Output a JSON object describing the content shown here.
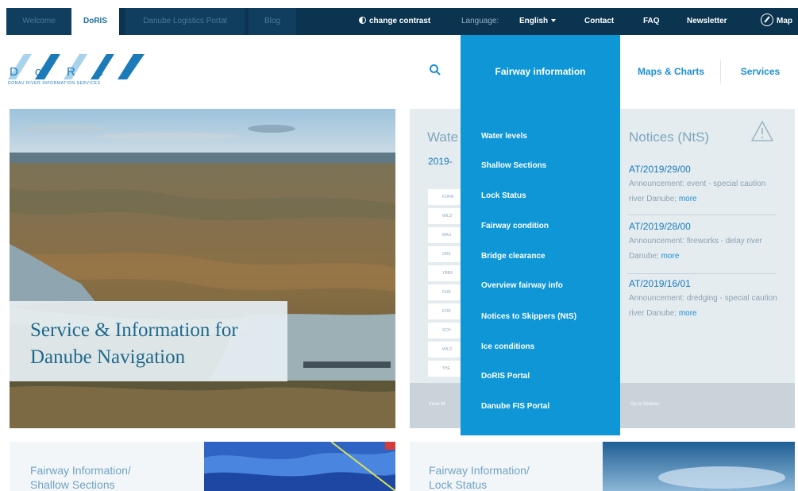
{
  "topbar": {
    "tabs": [
      "Welcome",
      "DoRIS",
      "Danube Logistics Portal",
      "Blog"
    ],
    "change_contrast": "change contrast",
    "language_label": "Language:",
    "language_value": "English",
    "contact": "Contact",
    "faq": "FAQ",
    "newsletter": "Newsletter",
    "map": "Map"
  },
  "logo": {
    "letters": [
      "D",
      "o",
      "R",
      "I",
      "S"
    ],
    "tagline": "DONAU RIVER INFORMATION SERVICES",
    "colors": {
      "dark": "#1b7bb8",
      "light": "#a9d2ec"
    }
  },
  "nav": {
    "search_icon": "search-icon",
    "items": [
      "Fairway information",
      "Maps & Charts",
      "Services"
    ]
  },
  "dropdown": {
    "items": [
      "Water levels",
      "Shallow Sections",
      "Lock Status",
      "Fairway condition",
      "Bridge clearance",
      "Overview fairway info",
      "Notices to Skippers (NtS)",
      "Ice conditions",
      "DoRIS Portal",
      "Danube FIS Portal"
    ]
  },
  "hero": {
    "line1": "Service & Information for",
    "line2": "Danube Navigation"
  },
  "water_levels": {
    "title": "Wate",
    "date": "2019-",
    "stations": [
      "KORN",
      "WILD",
      "MAU",
      "GRE",
      "YBBS",
      "DUR",
      "KOR",
      "SCH",
      "WILD",
      "THE"
    ],
    "more_link": "more M"
  },
  "notices": {
    "title": "Notices (NtS)",
    "items": [
      {
        "code": "AT/2019/29/00",
        "text": "Announcement: event - special caution river Danube;",
        "more": "more"
      },
      {
        "code": "AT/2019/28/00",
        "text": "Announcement: fireworks - delay river Danube;",
        "more": "more"
      },
      {
        "code": "AT/2019/16/01",
        "text": "Announcement: dredging - special caution river Danube;",
        "more": "more"
      }
    ],
    "go_to": "Go to Notices"
  },
  "teasers": [
    {
      "line1": "Fairway Information/",
      "line2": "Shallow Sections"
    },
    {
      "line1": "Fairway Information/",
      "line2": "Lock Status"
    }
  ]
}
